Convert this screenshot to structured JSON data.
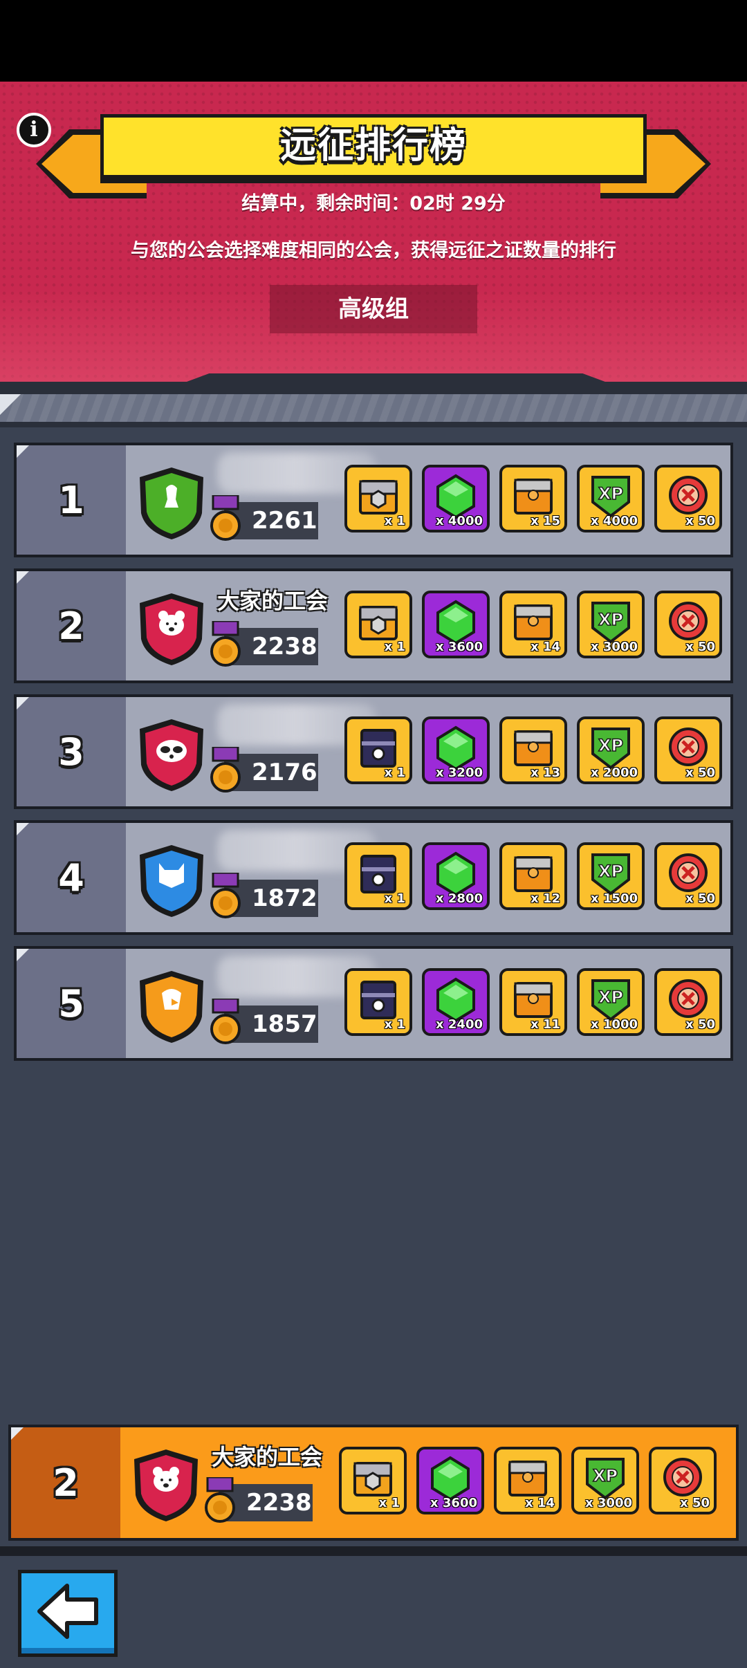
{
  "header": {
    "title": "远征排行榜",
    "timer": "结算中，剩余时间：02时 29分",
    "description": "与您的公会选择难度相同的公会，获得远征之证数量的排行",
    "group": "高级组"
  },
  "rankings": [
    {
      "rank": "1",
      "name": "",
      "score": "2261",
      "badge_color": "#4caf28",
      "badge_icon": "bird-icon",
      "rewards": [
        {
          "type": "chest-gold",
          "qty": "x 1"
        },
        {
          "type": "gem",
          "qty": "x 4000"
        },
        {
          "type": "chest-small",
          "qty": "x 15"
        },
        {
          "type": "xp",
          "qty": "x 4000"
        },
        {
          "type": "token",
          "qty": "x 50"
        }
      ]
    },
    {
      "rank": "2",
      "name": "大家的工会",
      "score": "2238",
      "badge_color": "#d8234d",
      "badge_icon": "bear-icon",
      "rewards": [
        {
          "type": "chest-gold",
          "qty": "x 1"
        },
        {
          "type": "gem",
          "qty": "x 3600"
        },
        {
          "type": "chest-small",
          "qty": "x 14"
        },
        {
          "type": "xp",
          "qty": "x 3000"
        },
        {
          "type": "token",
          "qty": "x 50"
        }
      ]
    },
    {
      "rank": "3",
      "name": "",
      "score": "2176",
      "badge_color": "#d8234d",
      "badge_icon": "raccoon-icon",
      "rewards": [
        {
          "type": "chest-dark",
          "qty": "x 1"
        },
        {
          "type": "gem",
          "qty": "x 3200"
        },
        {
          "type": "chest-small",
          "qty": "x 13"
        },
        {
          "type": "xp",
          "qty": "x 2000"
        },
        {
          "type": "token",
          "qty": "x 50"
        }
      ]
    },
    {
      "rank": "4",
      "name": "",
      "score": "1872",
      "badge_color": "#2d8be3",
      "badge_icon": "cat-icon",
      "rewards": [
        {
          "type": "chest-dark",
          "qty": "x 1"
        },
        {
          "type": "gem",
          "qty": "x 2800"
        },
        {
          "type": "chest-small",
          "qty": "x 12"
        },
        {
          "type": "xp",
          "qty": "x 1500"
        },
        {
          "type": "token",
          "qty": "x 50"
        }
      ]
    },
    {
      "rank": "5",
      "name": "",
      "score": "1857",
      "badge_color": "#f59b1b",
      "badge_icon": "eagle-icon",
      "rewards": [
        {
          "type": "chest-dark",
          "qty": "x 1"
        },
        {
          "type": "gem",
          "qty": "x 2400"
        },
        {
          "type": "chest-small",
          "qty": "x 11"
        },
        {
          "type": "xp",
          "qty": "x 1000"
        },
        {
          "type": "token",
          "qty": "x 50"
        }
      ]
    }
  ],
  "my_guild": {
    "rank": "2",
    "name": "大家的工会",
    "score": "2238",
    "badge_color": "#d8234d",
    "badge_icon": "bear-icon",
    "rewards": [
      {
        "type": "chest-gold",
        "qty": "x 1"
      },
      {
        "type": "gem",
        "qty": "x 3600"
      },
      {
        "type": "chest-small",
        "qty": "x 14"
      },
      {
        "type": "xp",
        "qty": "x 3000"
      },
      {
        "type": "token",
        "qty": "x 50"
      }
    ]
  },
  "controls": {
    "back_icon": "back-arrow-icon"
  },
  "colors": {
    "header_bg": "#c8284f",
    "banner_yellow": "#ffe22b",
    "my_row_orange": "#fb9b1a",
    "back_blue": "#28a9ee"
  }
}
